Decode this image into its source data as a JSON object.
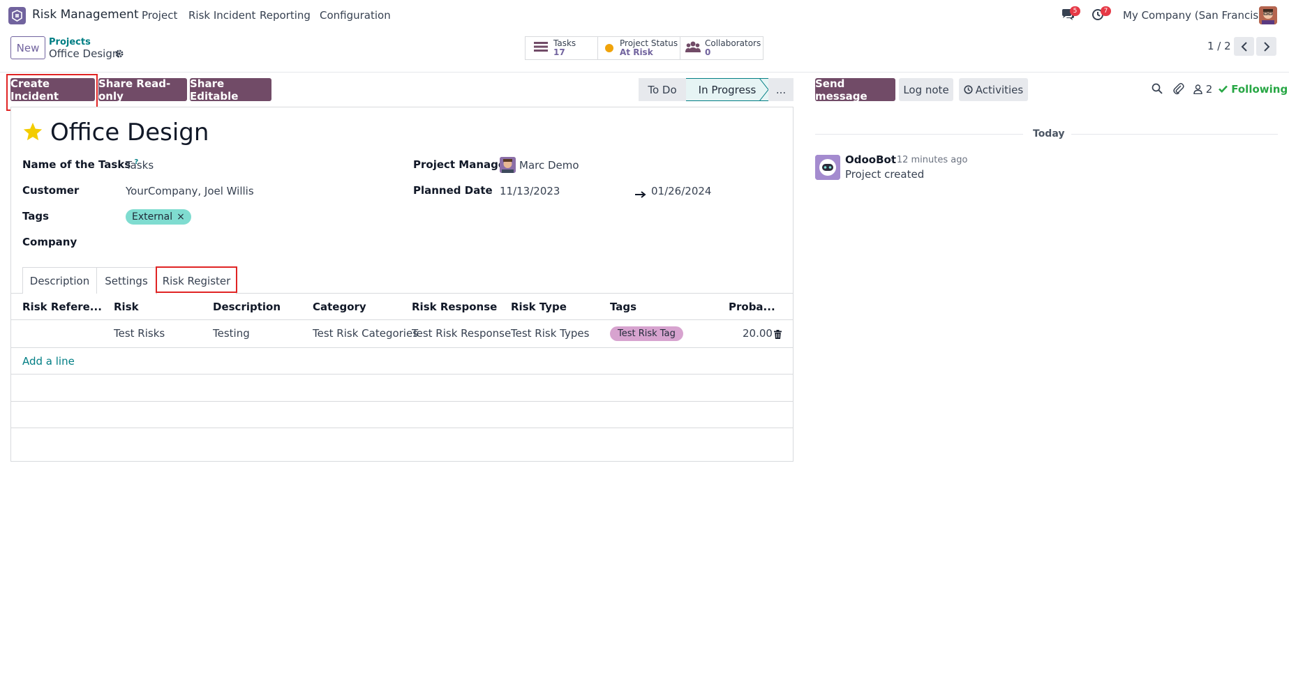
{
  "navbar": {
    "app_name": "Risk Management",
    "menus": [
      "Project",
      "Risk Incident",
      "Reporting",
      "Configuration"
    ],
    "messages_count": "5",
    "activities_count": "7",
    "company": "My Company (San Francisco)"
  },
  "control": {
    "new_label": "New",
    "breadcrumb_parent": "Projects",
    "breadcrumb_current": "Office Design",
    "stats": {
      "tasks_label": "Tasks",
      "tasks_value": "17",
      "status_label": "Project Status",
      "status_value": "At Risk",
      "status_color": "#f0a30a",
      "collab_label": "Collaborators",
      "collab_value": "0"
    },
    "pager": "1 / 2"
  },
  "actions": {
    "create_incident": "Create Incident",
    "share_readonly": "Share Read-only",
    "share_editable": "Share Editable"
  },
  "stages": {
    "todo": "To Do",
    "in_progress": "In Progress",
    "more": "..."
  },
  "form": {
    "title": "Office Design",
    "name_tasks_label": "Name of the Tasks",
    "name_tasks_help": "?",
    "name_tasks_value": "Tasks",
    "customer_label": "Customer",
    "customer_value": "YourCompany, Joel Willis",
    "tags_label": "Tags",
    "tag_value": "External",
    "tag_remove": "×",
    "company_label": "Company",
    "pm_label": "Project Manager",
    "pm_value": "Marc Demo",
    "planned_label": "Planned Date",
    "planned_start": "11/13/2023",
    "planned_end": "01/26/2024"
  },
  "tabs": [
    "Description",
    "Settings",
    "Risk Register"
  ],
  "table": {
    "headers": [
      "Risk Refere...",
      "Risk",
      "Description",
      "Category",
      "Risk Response",
      "Risk Type",
      "Tags",
      "Proba..."
    ],
    "rows": [
      {
        "reference": "",
        "risk": "Test Risks",
        "description": "Testing",
        "category": "Test Risk Categories",
        "response": "Test Risk Response",
        "type": "Test Risk Types",
        "tag": "Test Risk Tag",
        "probability": "20.00"
      }
    ],
    "add_line": "Add a line"
  },
  "chatter": {
    "send_message": "Send message",
    "log_note": "Log note",
    "activities": "Activities",
    "followers_count": "2",
    "following": "Following",
    "date_separator": "Today",
    "messages": [
      {
        "author": "OdooBot",
        "time": "- 12 minutes ago",
        "body": "Project created"
      }
    ]
  }
}
